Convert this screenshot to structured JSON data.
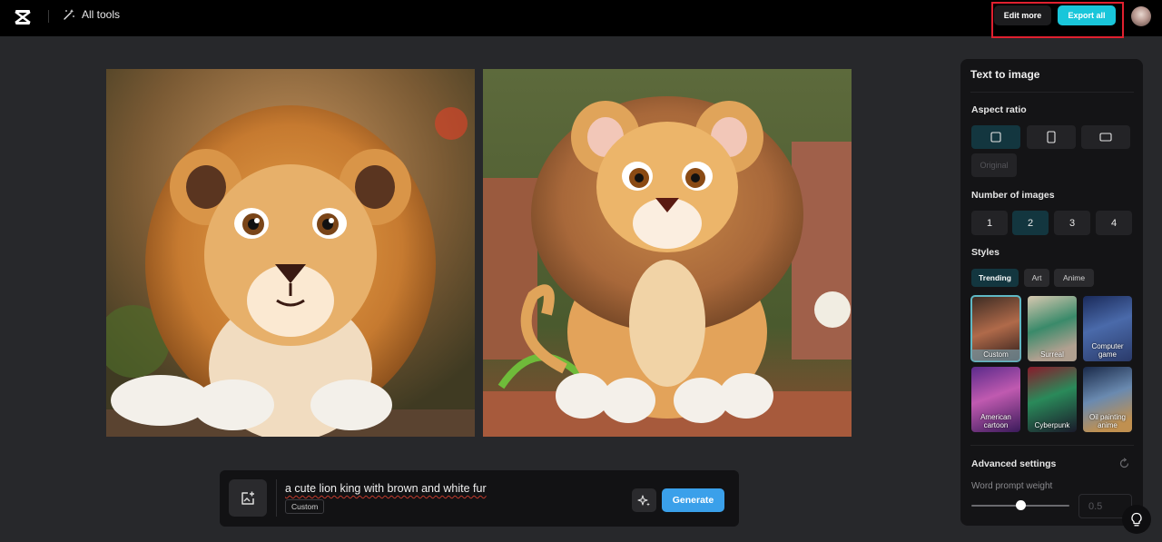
{
  "topbar": {
    "all_tools_label": "All tools",
    "edit_more_label": "Edit more",
    "export_all_label": "Export all"
  },
  "prompt": {
    "text": "a cute lion king with brown and white fur",
    "style_chip": "Custom",
    "generate_label": "Generate"
  },
  "panel": {
    "title": "Text to image",
    "aspect_ratio_label": "Aspect ratio",
    "aspect_ratio_original": "Original",
    "selected_aspect_ratio": "square",
    "number_of_images_label": "Number of images",
    "number_options": [
      "1",
      "2",
      "3",
      "4"
    ],
    "selected_number": "2",
    "styles_label": "Styles",
    "style_tabs": [
      "Trending",
      "Art",
      "Anime"
    ],
    "selected_tab": "Trending",
    "styles": [
      {
        "label": "Custom"
      },
      {
        "label": "Surreal"
      },
      {
        "label": "Computer game"
      },
      {
        "label": "American cartoon"
      },
      {
        "label": "Cyberpunk"
      },
      {
        "label": "Oil painting anime"
      }
    ],
    "selected_style": "Custom",
    "advanced_label": "Advanced settings",
    "word_prompt_weight_label": "Word prompt weight",
    "word_prompt_weight_value": "0.5"
  },
  "colors": {
    "accent_cyan": "#19c6da",
    "generate_blue": "#3aa0ea",
    "highlight_red": "#e0202f",
    "selected_bg": "#13363f"
  },
  "icons": [
    "capcut-logo-icon",
    "magic-wand-icon",
    "avatar",
    "upload-image-icon",
    "sparkle-icon",
    "square-icon",
    "portrait-icon",
    "landscape-icon",
    "reset-icon",
    "lightbulb-icon"
  ]
}
